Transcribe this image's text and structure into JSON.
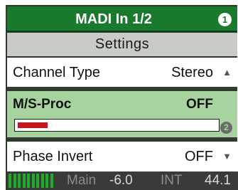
{
  "header": {
    "title": "MADI In 1/2",
    "badge": "1"
  },
  "subtitle": "Settings",
  "channel_type": {
    "label": "Channel Type",
    "value": "Stereo",
    "arrow_icon": "triangle-up-icon"
  },
  "ms_proc": {
    "label": "M/S-Proc",
    "value": "OFF",
    "level_fraction": 0.15,
    "badge": "2",
    "accent": "#a7d49e",
    "bar_color": "#c8141c"
  },
  "phase_invert": {
    "label": "Phase Invert",
    "value": "OFF",
    "arrow_icon": "triangle-down-icon"
  },
  "status": {
    "meter_color": "#1faa2a",
    "output": "Main",
    "gain": "-6.0",
    "clock": "INT",
    "rate": "44.1"
  },
  "colors": {
    "title_bg": "#197a2e",
    "subtitle_bg": "#c8cbc6",
    "status_bg": "#3a3a3a"
  }
}
